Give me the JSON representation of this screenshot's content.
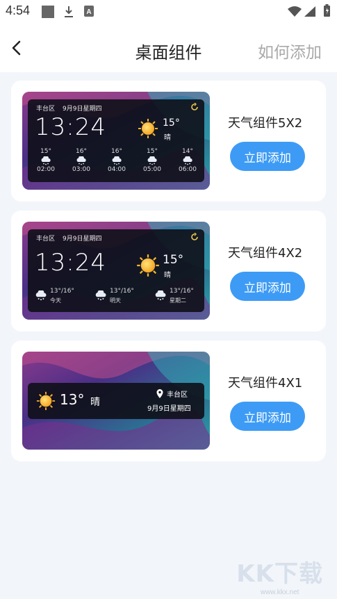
{
  "status_bar": {
    "time": "4:54",
    "icons": [
      "square-icon",
      "download-icon",
      "font-icon",
      "wifi-icon",
      "signal-icon",
      "battery-icon"
    ]
  },
  "header": {
    "title": "桌面组件",
    "action_label": "如何添加",
    "back_icon": "chevron-left-icon"
  },
  "widgets": [
    {
      "name": "天气组件5X2",
      "button_label": "立即添加",
      "preview": {
        "location": "丰台区",
        "date": "9月9日星期四",
        "time": "13:24",
        "temp": "15°",
        "condition": "晴",
        "hourly": [
          {
            "temp": "15°",
            "time": "02:00"
          },
          {
            "temp": "16°",
            "time": "03:00"
          },
          {
            "temp": "16°",
            "time": "04:00"
          },
          {
            "temp": "15°",
            "time": "05:00"
          },
          {
            "temp": "14°",
            "time": "06:00"
          }
        ]
      }
    },
    {
      "name": "天气组件4X2",
      "button_label": "立即添加",
      "preview": {
        "location": "丰台区",
        "date": "9月9日星期四",
        "time": "13:24",
        "temp": "15°",
        "condition": "晴",
        "daily": [
          {
            "temp": "13°/16°",
            "label": "今天"
          },
          {
            "temp": "13°/16°",
            "label": "明天"
          },
          {
            "temp": "13°/16°",
            "label": "星期二"
          }
        ]
      }
    },
    {
      "name": "天气组件4X1",
      "button_label": "立即添加",
      "preview": {
        "temp": "13°",
        "condition": "晴",
        "location": "丰台区",
        "date": "9月9日星期四"
      }
    }
  ],
  "watermark": {
    "text": "KK下载",
    "url": "www.kkx.net"
  },
  "colors": {
    "accent": "#3d9bf5",
    "background": "#f2f5fa",
    "card": "#ffffff",
    "panel": "#0e1018",
    "sun": "#f7b52c"
  }
}
